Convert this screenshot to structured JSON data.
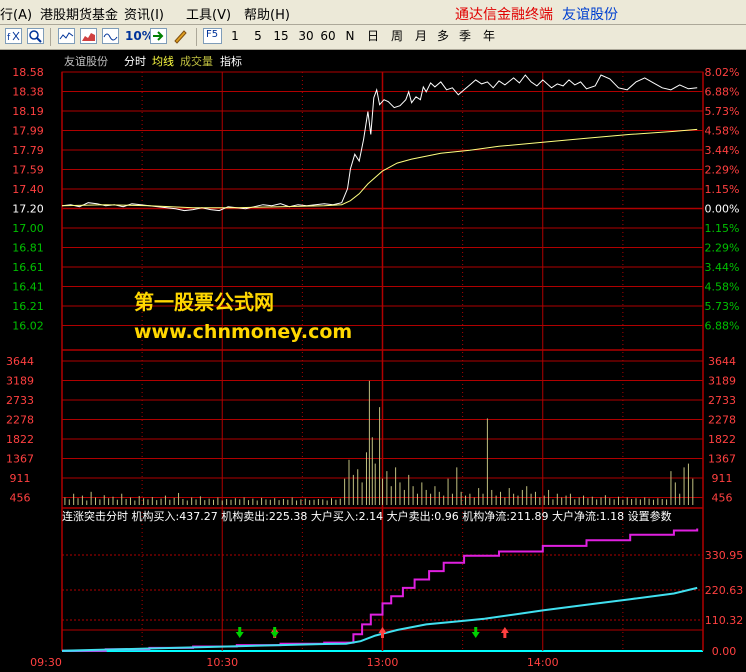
{
  "menubar": {
    "items": [
      {
        "label": "行(A)"
      },
      {
        "label": "港股期货基金"
      },
      {
        "label": "资讯(I)"
      },
      {
        "label": "工具(V)"
      },
      {
        "label": "帮助(H)"
      }
    ],
    "brand": "通达信金融终端",
    "stock": "友谊股份"
  },
  "toolbar": {
    "pct_label": "10%",
    "f5_label": "F5",
    "periods": [
      "1",
      "5",
      "15",
      "30",
      "60",
      "N",
      "日",
      "周",
      "月",
      "多",
      "季",
      "年"
    ]
  },
  "header": {
    "stock_name": "友谊股份",
    "tab_timeshare": "分时",
    "tab_avg": "均线",
    "tab_volume": "成交量",
    "tab_indicator": "指标"
  },
  "watermark": {
    "title": "第一股票公式网",
    "url": "www.chnmoney.com"
  },
  "indicator_header": {
    "text": "连涨突击分时  机构买入:437.27  机构卖出:225.38  大户买入:2.14  大户卖出:0.96  机构净流:211.89  大户净流:1.18  设置参数"
  },
  "chart_data": {
    "type": "line",
    "price_axis": [
      "18.58",
      "18.38",
      "18.19",
      "17.99",
      "17.79",
      "17.59",
      "17.40",
      "17.20",
      "17.00",
      "16.81",
      "16.61",
      "16.41",
      "16.21",
      "16.02"
    ],
    "pct_axis": [
      "8.02%",
      "6.88%",
      "5.73%",
      "4.58%",
      "3.44%",
      "2.29%",
      "1.15%",
      "0.00%",
      "1.15%",
      "2.29%",
      "3.44%",
      "4.58%",
      "5.73%",
      "6.88%"
    ],
    "prev_close": 17.2,
    "volume_axis": [
      "3644",
      "3189",
      "2733",
      "2278",
      "1822",
      "1367",
      "911",
      "456"
    ],
    "indicator_axis": [
      "330.95",
      "220.63",
      "110.32",
      "0.00"
    ],
    "time_axis": [
      "09:30",
      "10:30",
      "13:00",
      "14:00"
    ],
    "price_series": [
      [
        0,
        17.23
      ],
      [
        6,
        17.24
      ],
      [
        12,
        17.22
      ],
      [
        18,
        17.26
      ],
      [
        24,
        17.25
      ],
      [
        30,
        17.23
      ],
      [
        36,
        17.24
      ],
      [
        42,
        17.22
      ],
      [
        48,
        17.25
      ],
      [
        54,
        17.24
      ],
      [
        60,
        17.23
      ],
      [
        66,
        17.22
      ],
      [
        72,
        17.21
      ],
      [
        78,
        17.2
      ],
      [
        84,
        17.18
      ],
      [
        90,
        17.19
      ],
      [
        96,
        17.21
      ],
      [
        102,
        17.19
      ],
      [
        108,
        17.18
      ],
      [
        114,
        17.22
      ],
      [
        120,
        17.21
      ],
      [
        126,
        17.2
      ],
      [
        132,
        17.22
      ],
      [
        138,
        17.24
      ],
      [
        144,
        17.23
      ],
      [
        150,
        17.25
      ],
      [
        156,
        17.22
      ],
      [
        162,
        17.24
      ],
      [
        168,
        17.23
      ],
      [
        174,
        17.24
      ],
      [
        180,
        17.25
      ],
      [
        186,
        17.24
      ],
      [
        192,
        17.26
      ],
      [
        196,
        17.4
      ],
      [
        198,
        17.6
      ],
      [
        201,
        17.75
      ],
      [
        204,
        17.68
      ],
      [
        207,
        17.9
      ],
      [
        210,
        18.18
      ],
      [
        212,
        17.95
      ],
      [
        214,
        18.32
      ],
      [
        216,
        18.4
      ],
      [
        218,
        18.25
      ],
      [
        221,
        18.3
      ],
      [
        224,
        18.28
      ],
      [
        228,
        18.22
      ],
      [
        232,
        18.24
      ],
      [
        236,
        18.3
      ],
      [
        238,
        18.38
      ],
      [
        240,
        18.27
      ],
      [
        243,
        18.33
      ],
      [
        246,
        18.3
      ],
      [
        248,
        18.43
      ],
      [
        250,
        18.38
      ],
      [
        253,
        18.47
      ],
      [
        256,
        18.43
      ],
      [
        260,
        18.48
      ],
      [
        264,
        18.4
      ],
      [
        268,
        18.42
      ],
      [
        272,
        18.35
      ],
      [
        276,
        18.4
      ],
      [
        280,
        18.45
      ],
      [
        284,
        18.5
      ],
      [
        288,
        18.46
      ],
      [
        292,
        18.48
      ],
      [
        296,
        18.42
      ],
      [
        300,
        18.49
      ],
      [
        304,
        18.45
      ],
      [
        310,
        18.52
      ],
      [
        314,
        18.47
      ],
      [
        318,
        18.55
      ],
      [
        322,
        18.48
      ],
      [
        326,
        18.44
      ],
      [
        330,
        18.5
      ],
      [
        336,
        18.42
      ],
      [
        340,
        18.46
      ],
      [
        344,
        18.44
      ],
      [
        348,
        18.5
      ],
      [
        352,
        18.45
      ],
      [
        356,
        18.48
      ],
      [
        360,
        18.41
      ],
      [
        366,
        18.44
      ],
      [
        370,
        18.55
      ],
      [
        376,
        18.51
      ],
      [
        382,
        18.42
      ],
      [
        388,
        18.4
      ],
      [
        394,
        18.48
      ],
      [
        400,
        18.52
      ],
      [
        406,
        18.47
      ],
      [
        412,
        18.42
      ],
      [
        418,
        18.4
      ],
      [
        424,
        18.45
      ],
      [
        430,
        18.41
      ],
      [
        436,
        18.42
      ]
    ],
    "avg_series": [
      [
        0,
        17.23
      ],
      [
        30,
        17.24
      ],
      [
        60,
        17.23
      ],
      [
        90,
        17.21
      ],
      [
        120,
        17.21
      ],
      [
        150,
        17.22
      ],
      [
        180,
        17.23
      ],
      [
        192,
        17.24
      ],
      [
        198,
        17.28
      ],
      [
        204,
        17.35
      ],
      [
        210,
        17.45
      ],
      [
        220,
        17.58
      ],
      [
        230,
        17.66
      ],
      [
        240,
        17.7
      ],
      [
        260,
        17.76
      ],
      [
        280,
        17.79
      ],
      [
        300,
        17.83
      ],
      [
        330,
        17.87
      ],
      [
        360,
        17.91
      ],
      [
        390,
        17.95
      ],
      [
        420,
        17.98
      ],
      [
        436,
        18.0
      ]
    ],
    "volume_series": [
      [
        2,
        200
      ],
      [
        5,
        150
      ],
      [
        8,
        300
      ],
      [
        11,
        180
      ],
      [
        14,
        250
      ],
      [
        17,
        120
      ],
      [
        20,
        350
      ],
      [
        23,
        200
      ],
      [
        26,
        150
      ],
      [
        29,
        260
      ],
      [
        32,
        180
      ],
      [
        35,
        220
      ],
      [
        38,
        140
      ],
      [
        41,
        300
      ],
      [
        44,
        160
      ],
      [
        47,
        200
      ],
      [
        50,
        120
      ],
      [
        53,
        240
      ],
      [
        56,
        180
      ],
      [
        59,
        150
      ],
      [
        62,
        210
      ],
      [
        65,
        130
      ],
      [
        68,
        170
      ],
      [
        71,
        250
      ],
      [
        74,
        140
      ],
      [
        77,
        190
      ],
      [
        80,
        320
      ],
      [
        83,
        160
      ],
      [
        86,
        120
      ],
      [
        89,
        200
      ],
      [
        92,
        150
      ],
      [
        95,
        230
      ],
      [
        98,
        130
      ],
      [
        101,
        170
      ],
      [
        104,
        140
      ],
      [
        107,
        200
      ],
      [
        110,
        120
      ],
      [
        113,
        160
      ],
      [
        116,
        140
      ],
      [
        119,
        180
      ],
      [
        122,
        150
      ],
      [
        125,
        200
      ],
      [
        128,
        130
      ],
      [
        131,
        170
      ],
      [
        134,
        120
      ],
      [
        137,
        190
      ],
      [
        140,
        150
      ],
      [
        143,
        140
      ],
      [
        146,
        180
      ],
      [
        149,
        130
      ],
      [
        152,
        160
      ],
      [
        155,
        140
      ],
      [
        158,
        200
      ],
      [
        161,
        120
      ],
      [
        164,
        150
      ],
      [
        167,
        170
      ],
      [
        170,
        130
      ],
      [
        173,
        140
      ],
      [
        176,
        160
      ],
      [
        179,
        150
      ],
      [
        182,
        120
      ],
      [
        185,
        180
      ],
      [
        188,
        140
      ],
      [
        191,
        170
      ],
      [
        194,
        700
      ],
      [
        197,
        1200
      ],
      [
        200,
        800
      ],
      [
        203,
        950
      ],
      [
        206,
        600
      ],
      [
        209,
        1400
      ],
      [
        211,
        3300
      ],
      [
        213,
        1800
      ],
      [
        215,
        1100
      ],
      [
        218,
        2600
      ],
      [
        220,
        700
      ],
      [
        223,
        900
      ],
      [
        226,
        500
      ],
      [
        229,
        1000
      ],
      [
        232,
        600
      ],
      [
        235,
        400
      ],
      [
        238,
        800
      ],
      [
        241,
        500
      ],
      [
        244,
        300
      ],
      [
        247,
        600
      ],
      [
        250,
        400
      ],
      [
        253,
        300
      ],
      [
        256,
        500
      ],
      [
        259,
        350
      ],
      [
        262,
        250
      ],
      [
        265,
        700
      ],
      [
        268,
        300
      ],
      [
        271,
        1000
      ],
      [
        274,
        350
      ],
      [
        277,
        250
      ],
      [
        280,
        300
      ],
      [
        283,
        200
      ],
      [
        286,
        450
      ],
      [
        289,
        300
      ],
      [
        292,
        2300
      ],
      [
        295,
        400
      ],
      [
        298,
        250
      ],
      [
        301,
        350
      ],
      [
        304,
        200
      ],
      [
        307,
        450
      ],
      [
        310,
        300
      ],
      [
        313,
        250
      ],
      [
        316,
        400
      ],
      [
        319,
        500
      ],
      [
        322,
        300
      ],
      [
        325,
        350
      ],
      [
        328,
        200
      ],
      [
        331,
        250
      ],
      [
        334,
        400
      ],
      [
        337,
        150
      ],
      [
        340,
        300
      ],
      [
        343,
        200
      ],
      [
        346,
        250
      ],
      [
        349,
        300
      ],
      [
        352,
        150
      ],
      [
        355,
        200
      ],
      [
        358,
        250
      ],
      [
        361,
        180
      ],
      [
        364,
        220
      ],
      [
        367,
        150
      ],
      [
        370,
        200
      ],
      [
        373,
        260
      ],
      [
        376,
        180
      ],
      [
        379,
        150
      ],
      [
        382,
        220
      ],
      [
        385,
        140
      ],
      [
        388,
        200
      ],
      [
        391,
        160
      ],
      [
        394,
        180
      ],
      [
        397,
        150
      ],
      [
        400,
        200
      ],
      [
        403,
        170
      ],
      [
        406,
        140
      ],
      [
        409,
        180
      ],
      [
        412,
        160
      ],
      [
        415,
        150
      ],
      [
        418,
        900
      ],
      [
        421,
        600
      ],
      [
        424,
        300
      ],
      [
        427,
        1000
      ],
      [
        430,
        1100
      ],
      [
        433,
        700
      ]
    ],
    "series": [
      {
        "name": "机构买入",
        "values": [
          [
            0,
            1
          ],
          [
            30,
            6
          ],
          [
            60,
            11
          ],
          [
            90,
            16
          ],
          [
            120,
            21
          ],
          [
            150,
            26
          ],
          [
            180,
            30
          ],
          [
            195,
            30
          ],
          [
            200,
            60
          ],
          [
            206,
            95
          ],
          [
            212,
            130
          ],
          [
            220,
            170
          ],
          [
            226,
            195
          ],
          [
            234,
            225
          ],
          [
            242,
            255
          ],
          [
            252,
            285
          ],
          [
            262,
            315
          ],
          [
            276,
            340
          ],
          [
            300,
            355
          ],
          [
            330,
            375
          ],
          [
            360,
            395
          ],
          [
            390,
            415
          ],
          [
            420,
            430
          ],
          [
            436,
            437
          ]
        ]
      },
      {
        "name": "机构卖出",
        "values": [
          [
            0,
            1
          ],
          [
            30,
            5
          ],
          [
            60,
            9
          ],
          [
            90,
            13
          ],
          [
            120,
            17
          ],
          [
            150,
            21
          ],
          [
            180,
            25
          ],
          [
            195,
            26
          ],
          [
            205,
            35
          ],
          [
            215,
            55
          ],
          [
            230,
            75
          ],
          [
            250,
            95
          ],
          [
            270,
            105
          ],
          [
            290,
            115
          ],
          [
            310,
            130
          ],
          [
            330,
            145
          ],
          [
            360,
            165
          ],
          [
            390,
            185
          ],
          [
            420,
            205
          ],
          [
            436,
            225
          ]
        ]
      }
    ],
    "buy_arrows": [
      146,
      220,
      304
    ],
    "sell_arrows": [
      122,
      146,
      284
    ]
  }
}
